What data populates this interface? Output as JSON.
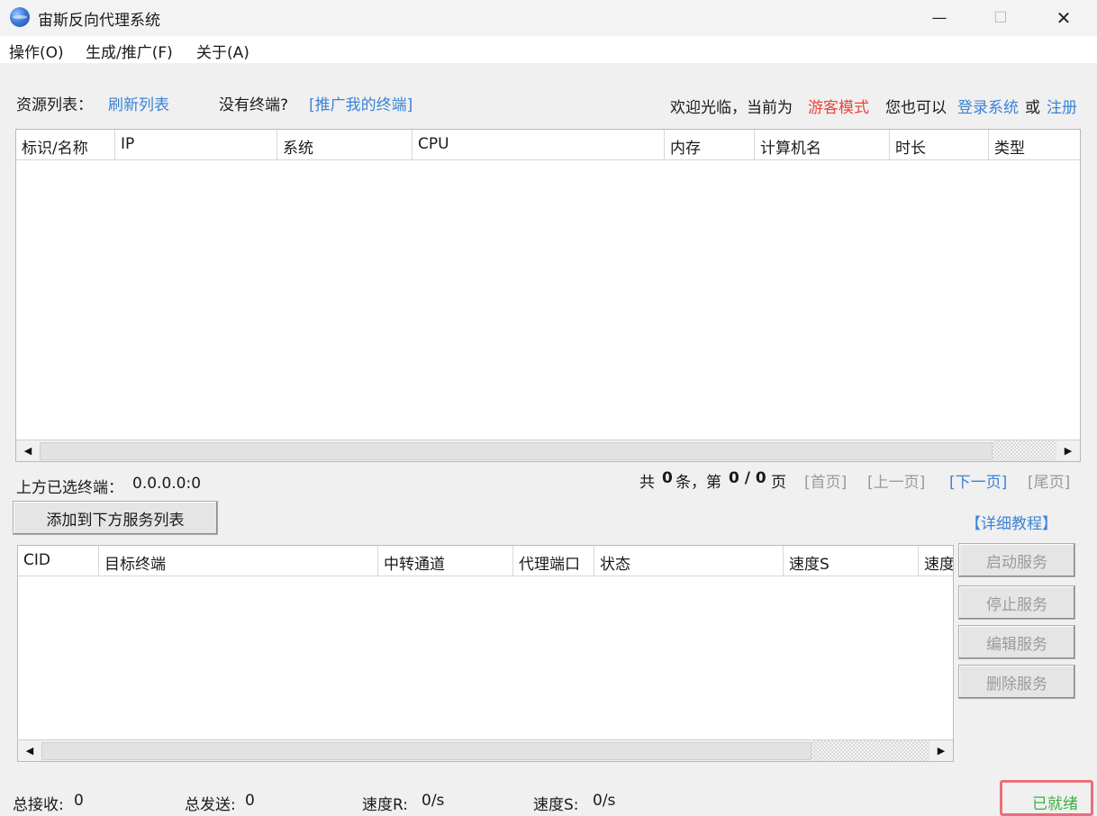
{
  "window": {
    "title": "宙斯反向代理系统",
    "minimize": "—",
    "maximize": "☐",
    "close": "✕"
  },
  "menu": [
    "操作(O)",
    "生成/推广(F)",
    "关于(A)"
  ],
  "resource_bar": {
    "label": "资源列表：",
    "refresh": "刷新列表",
    "no_terminal": "没有终端?",
    "promote": "[推广我的终端]",
    "welcome": "欢迎光临，当前为",
    "mode": "游客模式",
    "you_can": "您也可以",
    "login": "登录系统",
    "or": "或",
    "register": "注册"
  },
  "resource_table": {
    "columns": [
      "标识/名称",
      "IP",
      "系统",
      "CPU",
      "内存",
      "计算机名",
      "时长",
      "类型"
    ]
  },
  "selection": {
    "label": "上方已选终端：",
    "value": "0.0.0.0:0"
  },
  "pagination": {
    "total_prefix": "共",
    "total": "0",
    "total_suffix": "条，第",
    "page": "0 / 0",
    "page_suffix": "页",
    "first": "[首页]",
    "prev": "[上一页]",
    "next": "[下一页]",
    "last": "[尾页]"
  },
  "add_button": "添加到下方服务列表",
  "tutorial": "【详细教程】",
  "service_table": {
    "columns": [
      "CID",
      "目标终端",
      "中转通道",
      "代理端口",
      "状态",
      "速度S",
      "速度R"
    ]
  },
  "service_buttons": [
    "启动服务",
    "停止服务",
    "编辑服务",
    "删除服务"
  ],
  "status_bar": {
    "recv_label": "总接收:",
    "recv_value": "0",
    "send_label": "总发送:",
    "send_value": "0",
    "speed_r_label": "速度R:",
    "speed_r_value": "0/s",
    "speed_s_label": "速度S:",
    "speed_s_value": "0/s",
    "state": "已就绪"
  },
  "colors": {
    "link": "#3b83d6",
    "mode": "#e8453c",
    "ready": "#3cb043"
  }
}
